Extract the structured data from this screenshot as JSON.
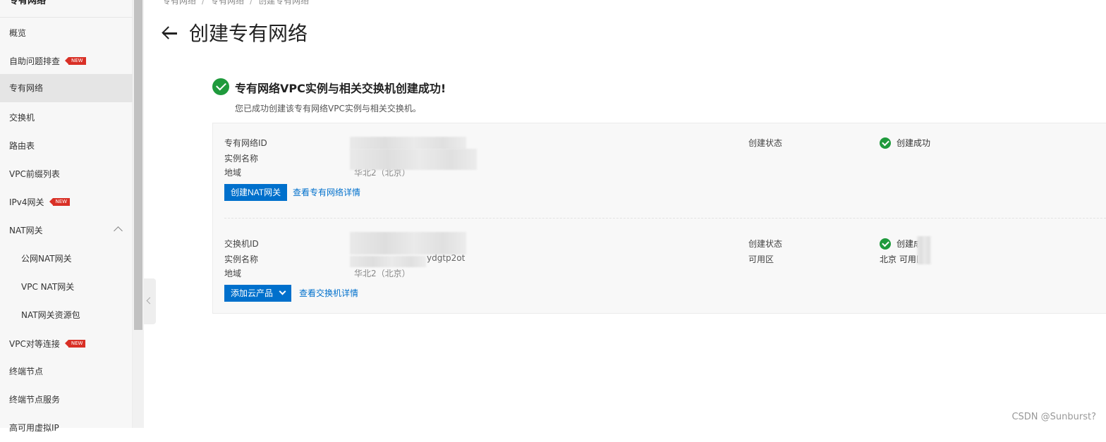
{
  "sidebar": {
    "title": "专有网络",
    "items": [
      {
        "label": "概览"
      },
      {
        "label": "自助问题排查",
        "badge": "NEW"
      },
      {
        "label": "专有网络"
      },
      {
        "label": "交换机"
      },
      {
        "label": "路由表"
      },
      {
        "label": "VPC前缀列表"
      },
      {
        "label": "IPv4网关",
        "badge": "NEW"
      },
      {
        "label": "NAT网关"
      },
      {
        "label": "公网NAT网关"
      },
      {
        "label": "VPC NAT网关"
      },
      {
        "label": "NAT网关资源包"
      },
      {
        "label": "VPC对等连接",
        "badge": "NEW"
      },
      {
        "label": "终端节点"
      },
      {
        "label": "终端节点服务"
      },
      {
        "label": "高可用虚拟IP"
      }
    ]
  },
  "breadcrumb": [
    "专有网络",
    "专有网络",
    "创建专有网络"
  ],
  "page_title": "创建专有网络",
  "result": {
    "title": "专有网络VPC实例与相关交换机创建成功!",
    "description": "您已成功创建该专有网络VPC实例与相关交换机。"
  },
  "vpc": {
    "id_label": "专有网络ID",
    "name_label": "实例名称",
    "region_label": "地域",
    "region_value": "华北2（北京）",
    "status_label": "创建状态",
    "status_value": "创建成功",
    "primary_action": "创建NAT网关",
    "detail_link": "查看专有网络详情"
  },
  "vswitch": {
    "id_label": "交换机ID",
    "name_label": "实例名称",
    "name_partial": "ydgtp2ot",
    "region_label": "地域",
    "region_value": "华北2（北京）",
    "status_label": "创建状态",
    "status_value": "创建成功",
    "zone_label": "可用区",
    "zone_value": "北京 可用区",
    "primary_action": "添加云产品",
    "detail_link": "查看交换机详情"
  },
  "watermark": "CSDN @Sunburst?",
  "colors": {
    "primary": "#0070cc",
    "success": "#1f9a3c",
    "badge": "#d93026"
  }
}
